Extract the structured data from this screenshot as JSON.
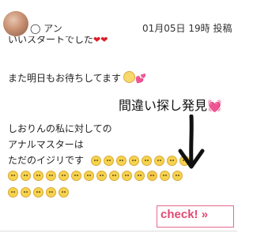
{
  "post": {
    "username": "◯ アン",
    "datetime": "01月05日 19時",
    "action_label": "投稿"
  },
  "lines": {
    "line1": "いいスタートでした",
    "line2": "また明日もお待ちしてます",
    "line3": "しおりんの私に対しての",
    "line4": "アナルマスターは",
    "line5": "ただのイジリです"
  },
  "overlay": {
    "title": "間違い探し発見",
    "heart": "💓"
  },
  "glyphs": {
    "heart": "❤",
    "pink_heart": "💕"
  },
  "check_button": {
    "label": "check! »"
  },
  "emoji_rows": {
    "row_inline_count": 8,
    "row2_count": 14,
    "row3_count": 5,
    "odd_face_row": 2,
    "odd_face_index": 11
  },
  "colors": {
    "accent": "#e04a73",
    "overlay_heart": "#ff4fa3"
  }
}
